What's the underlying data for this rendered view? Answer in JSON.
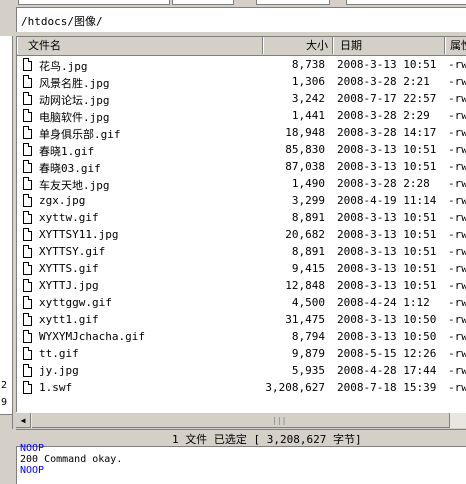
{
  "path": "/htdocs/图像/",
  "columns": {
    "name": "文件名",
    "size": "大小",
    "date": "日期",
    "attr": "属性"
  },
  "files": [
    {
      "name": "花鸟.jpg",
      "size": "8,738",
      "date": "2008-3-13 10:51",
      "attr": "-rw"
    },
    {
      "name": "风景名胜.jpg",
      "size": "1,306",
      "date": "2008-3-28 2:21",
      "attr": "-rw"
    },
    {
      "name": "动网论坛.jpg",
      "size": "3,242",
      "date": "2008-7-17 22:57",
      "attr": "-rw"
    },
    {
      "name": "电脑软件.jpg",
      "size": "1,441",
      "date": "2008-3-28 2:29",
      "attr": "-rw"
    },
    {
      "name": "单身俱乐部.gif",
      "size": "18,948",
      "date": "2008-3-28 14:17",
      "attr": "-rw"
    },
    {
      "name": "春晓1.gif",
      "size": "85,830",
      "date": "2008-3-13 10:51",
      "attr": "-rw"
    },
    {
      "name": "春晓03.gif",
      "size": "87,038",
      "date": "2008-3-13 10:51",
      "attr": "-rw"
    },
    {
      "name": "车友天地.jpg",
      "size": "1,490",
      "date": "2008-3-28 2:28",
      "attr": "-rw"
    },
    {
      "name": "zgx.jpg",
      "size": "3,299",
      "date": "2008-4-19 11:14",
      "attr": "-rw"
    },
    {
      "name": "xyttw.gif",
      "size": "8,891",
      "date": "2008-3-13 10:51",
      "attr": "-rw"
    },
    {
      "name": "XYTTSY11.jpg",
      "size": "20,682",
      "date": "2008-3-13 10:51",
      "attr": "-rw"
    },
    {
      "name": "XYTTSY.gif",
      "size": "8,891",
      "date": "2008-3-13 10:51",
      "attr": "-rw"
    },
    {
      "name": "XYTTS.gif",
      "size": "9,415",
      "date": "2008-3-13 10:51",
      "attr": "-rw"
    },
    {
      "name": "XYTTJ.jpg",
      "size": "12,848",
      "date": "2008-3-13 10:51",
      "attr": "-rw"
    },
    {
      "name": "xyttggw.gif",
      "size": "4,500",
      "date": "2008-4-24 1:12",
      "attr": "-rw"
    },
    {
      "name": "xytt1.gif",
      "size": "31,475",
      "date": "2008-3-13 10:50",
      "attr": "-rw"
    },
    {
      "name": "WYXYMJchacha.gif",
      "size": "8,794",
      "date": "2008-3-13 10:50",
      "attr": "-rw"
    },
    {
      "name": "tt.gif",
      "size": "9,879",
      "date": "2008-5-15 12:26",
      "attr": "-rw"
    },
    {
      "name": "jy.jpg",
      "size": "5,935",
      "date": "2008-4-28 17:44",
      "attr": "-rw"
    },
    {
      "name": "1.swf",
      "size": "3,208,627",
      "date": "2008-7-18 15:39",
      "attr": "-rw"
    }
  ],
  "left_numbers": [
    "2",
    "9"
  ],
  "status": "1 文件 已选定 [  3,208,627 字节]",
  "log": [
    {
      "text": "NOOP",
      "color": "#0000ff"
    },
    {
      "text": "200 Command okay.",
      "color": "#000000"
    },
    {
      "text": "NOOP",
      "color": "#0000ff"
    }
  ]
}
